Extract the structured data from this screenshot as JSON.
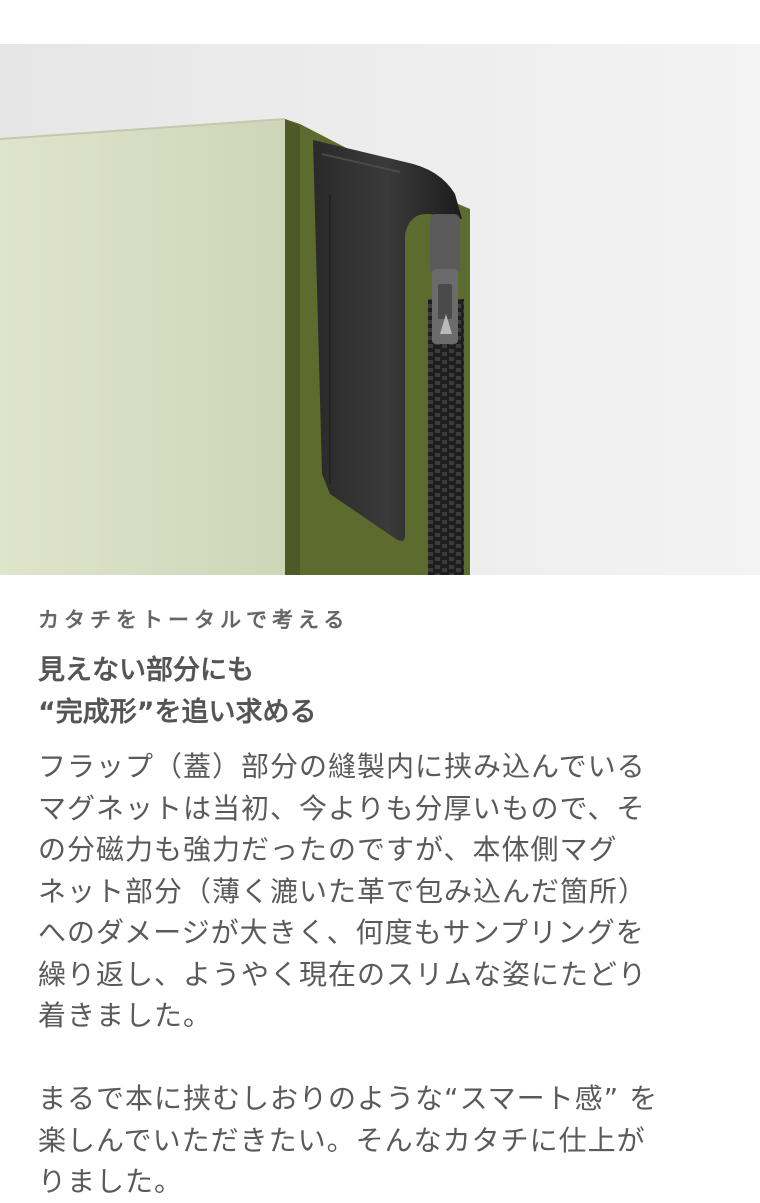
{
  "photo": {
    "alt_subject": "product-photo-magnet-flap-and-zipper"
  },
  "eyebrow": "カタチをトータルで考える",
  "headline": [
    "見えない部分にも",
    "“完成形”を追い求める"
  ],
  "paragraph1": [
    "フラップ（蓋）部分の縫製内に挟み込んでいる",
    "マグネットは当初、今よりも分厚いもので、そ",
    "の分磁力も強力だったのですが、本体側マグ",
    "ネット部分（薄く漉いた革で包み込んだ箇所）",
    "へのダメージが大きく、何度もサンプリングを",
    "繰り返し、ようやく現在のスリムな姿にたどり",
    "着きました。"
  ],
  "paragraph2": [
    "まるで本に挟むしおりのような“スマート感” を",
    "楽しんでいただきたい。そんなカタチに仕上が",
    "りました。"
  ]
}
